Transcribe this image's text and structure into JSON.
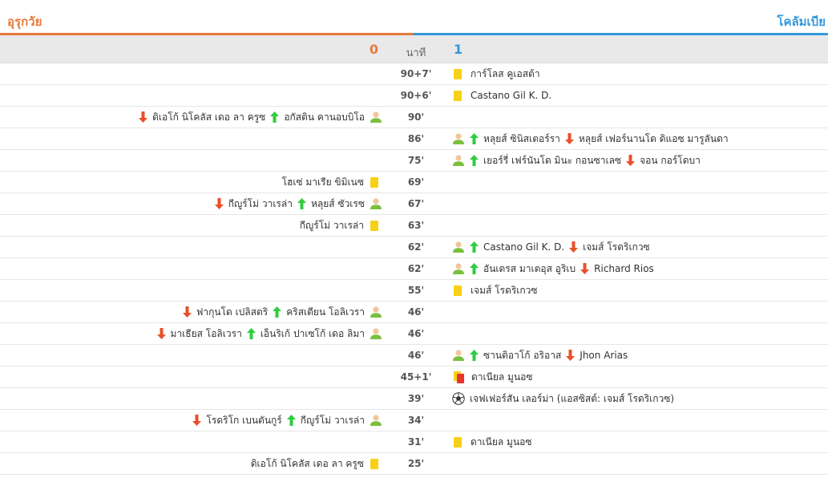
{
  "teams": {
    "home": "อุรุกวัย",
    "away": "โคลัมเบีย"
  },
  "header": {
    "home_score": "0",
    "minute_label": "นาที",
    "away_score": "1"
  },
  "events": [
    {
      "minute": "90+7'",
      "side": "away",
      "type": "yellow",
      "player": "การ์โลส คูเอสต้า"
    },
    {
      "minute": "90+6'",
      "side": "away",
      "type": "yellow",
      "player": "Castano Gil K. D."
    },
    {
      "minute": "90'",
      "side": "home",
      "type": "sub",
      "in": "อกัสติน คานอบบิโอ",
      "out": "ดิเอโก้ นิโคลัส เดอ ลา ครูซ"
    },
    {
      "minute": "86'",
      "side": "away",
      "type": "sub",
      "in": "หลุยส์ ซินิสเตอร์รา",
      "out": "หลุยส์ เฟอร์นานโด ดิแอซ มารูลันดา"
    },
    {
      "minute": "75'",
      "side": "away",
      "type": "sub",
      "in": "เยอร์รี่ เฟร์นันโด มินะ กอนซาเลซ",
      "out": "จอน กอร์โดบา"
    },
    {
      "minute": "69'",
      "side": "home",
      "type": "yellow",
      "player": "โฮเซ่ มาเรีย ขิมิเนซ"
    },
    {
      "minute": "67'",
      "side": "home",
      "type": "sub",
      "in": "หลุยส์ ซัวเรซ",
      "out": "กีญูร์โม่ วาเรล่า"
    },
    {
      "minute": "63'",
      "side": "home",
      "type": "yellow",
      "player": "กีญูร์โม่ วาเรล่า"
    },
    {
      "minute": "62'",
      "side": "away",
      "type": "sub",
      "in": "Castano Gil K. D.",
      "out": "เจมส์ โรดริเกวซ"
    },
    {
      "minute": "62'",
      "side": "away",
      "type": "sub",
      "in": "อันเดรส มาเตอุส อูริเบ",
      "out": "Richard Rios"
    },
    {
      "minute": "55'",
      "side": "away",
      "type": "yellow",
      "player": "เจมส์ โรดริเกวซ"
    },
    {
      "minute": "46'",
      "side": "home",
      "type": "sub",
      "in": "คริสเตียน โอลิเวรา",
      "out": "ฟากุนโด เปลิสตริ"
    },
    {
      "minute": "46'",
      "side": "home",
      "type": "sub",
      "in": "เอ็นริเก้ ปาเซโก้ เดอ ลิมา",
      "out": "มาเธียส โอลิเวรา"
    },
    {
      "minute": "46'",
      "side": "away",
      "type": "sub",
      "in": "ซานติอาโก้ อริอาส",
      "out": "Jhon Arias"
    },
    {
      "minute": "45+1'",
      "side": "away",
      "type": "second_yellow",
      "player": "ดาเนียล มูนอซ"
    },
    {
      "minute": "39'",
      "side": "away",
      "type": "goal",
      "player": "เจฟเฟอร์สัน เลอร์ม่า (แอสซิสต์: เจมส์ โรดริเกวซ)"
    },
    {
      "minute": "34'",
      "side": "home",
      "type": "sub",
      "in": "กีญูร์โม่ วาเรล่า",
      "out": "โรดริโก เบนตันกูร์"
    },
    {
      "minute": "31'",
      "side": "away",
      "type": "yellow",
      "player": "ดาเนียล มูนอซ"
    },
    {
      "minute": "25'",
      "side": "home",
      "type": "yellow",
      "player": "ดิเอโก้ นิโคลัส เดอ ลา ครูซ"
    }
  ],
  "icons": {
    "yellow_card": "yellow-card-icon",
    "second_yellow": "second-yellow-card-icon",
    "sub": "person-icon",
    "in": "arrow-up-icon",
    "out": "arrow-down-icon",
    "goal": "ball-icon"
  },
  "colors": {
    "home": "#e57a3c",
    "away": "#3498db",
    "yellow": "#f7d117",
    "red": "#e8342a",
    "arrow_in": "#2ecc40",
    "arrow_out": "#e8502a",
    "person_head": "#f2c59a",
    "person_body": "#7cbf3f"
  }
}
